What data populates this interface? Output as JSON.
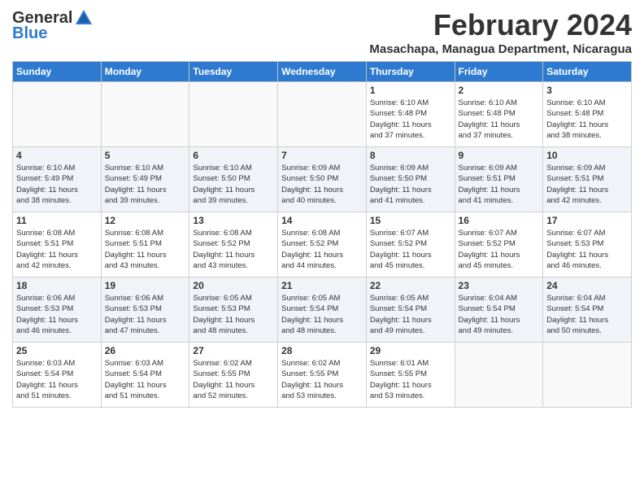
{
  "header": {
    "logo_general": "General",
    "logo_blue": "Blue",
    "month_year": "February 2024",
    "location": "Masachapa, Managua Department, Nicaragua"
  },
  "calendar": {
    "days_of_week": [
      "Sunday",
      "Monday",
      "Tuesday",
      "Wednesday",
      "Thursday",
      "Friday",
      "Saturday"
    ],
    "weeks": [
      [
        {
          "day": "",
          "info": ""
        },
        {
          "day": "",
          "info": ""
        },
        {
          "day": "",
          "info": ""
        },
        {
          "day": "",
          "info": ""
        },
        {
          "day": "1",
          "info": "Sunrise: 6:10 AM\nSunset: 5:48 PM\nDaylight: 11 hours\nand 37 minutes."
        },
        {
          "day": "2",
          "info": "Sunrise: 6:10 AM\nSunset: 5:48 PM\nDaylight: 11 hours\nand 37 minutes."
        },
        {
          "day": "3",
          "info": "Sunrise: 6:10 AM\nSunset: 5:48 PM\nDaylight: 11 hours\nand 38 minutes."
        }
      ],
      [
        {
          "day": "4",
          "info": "Sunrise: 6:10 AM\nSunset: 5:49 PM\nDaylight: 11 hours\nand 38 minutes."
        },
        {
          "day": "5",
          "info": "Sunrise: 6:10 AM\nSunset: 5:49 PM\nDaylight: 11 hours\nand 39 minutes."
        },
        {
          "day": "6",
          "info": "Sunrise: 6:10 AM\nSunset: 5:50 PM\nDaylight: 11 hours\nand 39 minutes."
        },
        {
          "day": "7",
          "info": "Sunrise: 6:09 AM\nSunset: 5:50 PM\nDaylight: 11 hours\nand 40 minutes."
        },
        {
          "day": "8",
          "info": "Sunrise: 6:09 AM\nSunset: 5:50 PM\nDaylight: 11 hours\nand 41 minutes."
        },
        {
          "day": "9",
          "info": "Sunrise: 6:09 AM\nSunset: 5:51 PM\nDaylight: 11 hours\nand 41 minutes."
        },
        {
          "day": "10",
          "info": "Sunrise: 6:09 AM\nSunset: 5:51 PM\nDaylight: 11 hours\nand 42 minutes."
        }
      ],
      [
        {
          "day": "11",
          "info": "Sunrise: 6:08 AM\nSunset: 5:51 PM\nDaylight: 11 hours\nand 42 minutes."
        },
        {
          "day": "12",
          "info": "Sunrise: 6:08 AM\nSunset: 5:51 PM\nDaylight: 11 hours\nand 43 minutes."
        },
        {
          "day": "13",
          "info": "Sunrise: 6:08 AM\nSunset: 5:52 PM\nDaylight: 11 hours\nand 43 minutes."
        },
        {
          "day": "14",
          "info": "Sunrise: 6:08 AM\nSunset: 5:52 PM\nDaylight: 11 hours\nand 44 minutes."
        },
        {
          "day": "15",
          "info": "Sunrise: 6:07 AM\nSunset: 5:52 PM\nDaylight: 11 hours\nand 45 minutes."
        },
        {
          "day": "16",
          "info": "Sunrise: 6:07 AM\nSunset: 5:52 PM\nDaylight: 11 hours\nand 45 minutes."
        },
        {
          "day": "17",
          "info": "Sunrise: 6:07 AM\nSunset: 5:53 PM\nDaylight: 11 hours\nand 46 minutes."
        }
      ],
      [
        {
          "day": "18",
          "info": "Sunrise: 6:06 AM\nSunset: 5:53 PM\nDaylight: 11 hours\nand 46 minutes."
        },
        {
          "day": "19",
          "info": "Sunrise: 6:06 AM\nSunset: 5:53 PM\nDaylight: 11 hours\nand 47 minutes."
        },
        {
          "day": "20",
          "info": "Sunrise: 6:05 AM\nSunset: 5:53 PM\nDaylight: 11 hours\nand 48 minutes."
        },
        {
          "day": "21",
          "info": "Sunrise: 6:05 AM\nSunset: 5:54 PM\nDaylight: 11 hours\nand 48 minutes."
        },
        {
          "day": "22",
          "info": "Sunrise: 6:05 AM\nSunset: 5:54 PM\nDaylight: 11 hours\nand 49 minutes."
        },
        {
          "day": "23",
          "info": "Sunrise: 6:04 AM\nSunset: 5:54 PM\nDaylight: 11 hours\nand 49 minutes."
        },
        {
          "day": "24",
          "info": "Sunrise: 6:04 AM\nSunset: 5:54 PM\nDaylight: 11 hours\nand 50 minutes."
        }
      ],
      [
        {
          "day": "25",
          "info": "Sunrise: 6:03 AM\nSunset: 5:54 PM\nDaylight: 11 hours\nand 51 minutes."
        },
        {
          "day": "26",
          "info": "Sunrise: 6:03 AM\nSunset: 5:54 PM\nDaylight: 11 hours\nand 51 minutes."
        },
        {
          "day": "27",
          "info": "Sunrise: 6:02 AM\nSunset: 5:55 PM\nDaylight: 11 hours\nand 52 minutes."
        },
        {
          "day": "28",
          "info": "Sunrise: 6:02 AM\nSunset: 5:55 PM\nDaylight: 11 hours\nand 53 minutes."
        },
        {
          "day": "29",
          "info": "Sunrise: 6:01 AM\nSunset: 5:55 PM\nDaylight: 11 hours\nand 53 minutes."
        },
        {
          "day": "",
          "info": ""
        },
        {
          "day": "",
          "info": ""
        }
      ]
    ]
  }
}
